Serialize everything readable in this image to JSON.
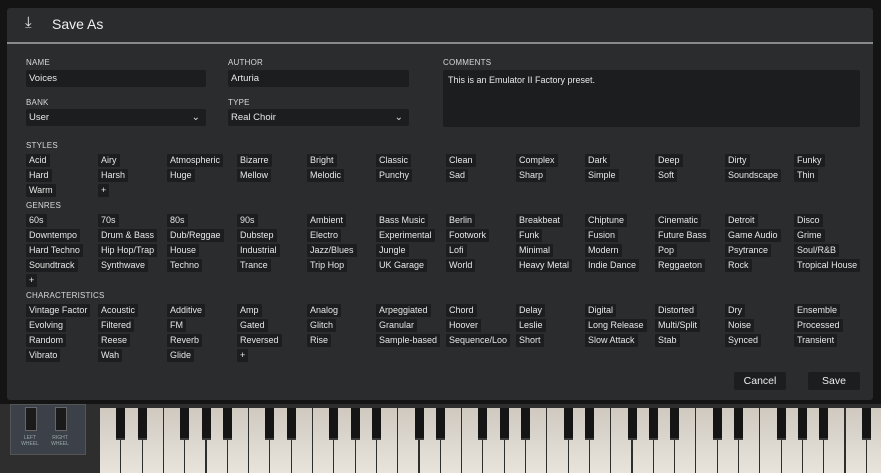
{
  "dialog": {
    "title": "Save As",
    "icon": "download-icon"
  },
  "fields": {
    "name_label": "NAME",
    "name_value": "Voices",
    "author_label": "AUTHOR",
    "author_value": "Arturia",
    "comments_label": "COMMENTS",
    "comments_value": "This is an Emulator II Factory preset.",
    "bank_label": "BANK",
    "bank_value": "User",
    "type_label": "TYPE",
    "type_value": "Real Choir"
  },
  "styles": {
    "label": "STYLES",
    "rows": [
      [
        "Acid",
        "Airy",
        "Atmospheric",
        "Bizarre",
        "Bright",
        "Classic",
        "Clean",
        "Complex",
        "Dark",
        "Deep",
        "Dirty",
        "Funky"
      ],
      [
        "Hard",
        "Harsh",
        "Huge",
        "Mellow",
        "Melodic",
        "Punchy",
        "Sad",
        "Sharp",
        "Simple",
        "Soft",
        "Soundscape",
        "Thin"
      ],
      [
        "Warm",
        "+"
      ]
    ]
  },
  "genres": {
    "label": "GENRES",
    "rows": [
      [
        "60s",
        "70s",
        "80s",
        "90s",
        "Ambient",
        "Bass Music",
        "Berlin",
        "Breakbeat",
        "Chiptune",
        "Cinematic",
        "Detroit",
        "Disco"
      ],
      [
        "Downtempo",
        "Drum & Bass",
        "Dub/Reggae",
        "Dubstep",
        "Electro",
        "Experimental",
        "Footwork",
        "Funk",
        "Fusion",
        "Future Bass",
        "Game Audio",
        "Grime"
      ],
      [
        "Hard Techno",
        "Hip Hop/Trap",
        "House",
        "Industrial",
        "Jazz/Blues",
        "Jungle",
        "Lofi",
        "Minimal",
        "Modern",
        "Pop",
        "Psytrance",
        "Soul/R&B"
      ],
      [
        "Soundtrack",
        "Synthwave",
        "Techno",
        "Trance",
        "Trip Hop",
        "UK Garage",
        "World",
        "Heavy Metal",
        "Indie Dance",
        "Reggaeton",
        "Rock",
        "Tropical House"
      ],
      [
        "+"
      ]
    ]
  },
  "characteristics": {
    "label": "CHARACTERISTICS",
    "rows": [
      [
        "Vintage Factor",
        "Acoustic",
        "Additive",
        "Amp",
        "Analog",
        "Arpeggiated",
        "Chord",
        "Delay",
        "Digital",
        "Distorted",
        "Dry",
        "Ensemble"
      ],
      [
        "Evolving",
        "Filtered",
        "FM",
        "Gated",
        "Glitch",
        "Granular",
        "Hoover",
        "Leslie",
        "Long Release",
        "Multi/Split",
        "Noise",
        "Processed"
      ],
      [
        "Random",
        "Reese",
        "Reverb",
        "Reversed",
        "Rise",
        "Sample-based",
        "Sequence/Loo",
        "Short",
        "Slow Attack",
        "Stab",
        "Synced",
        "Transient"
      ],
      [
        "Vibrato",
        "Wah",
        "Glide",
        "+"
      ]
    ]
  },
  "buttons": {
    "cancel": "Cancel",
    "save": "Save"
  },
  "keyboard": {
    "left_wheel": "LEFT WHEEL",
    "right_wheel": "RIGHT WHEEL"
  }
}
